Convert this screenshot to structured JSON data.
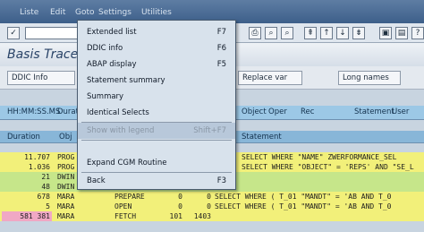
{
  "menubar": {
    "items": [
      "Liste",
      "Edit",
      "Goto",
      "Settings",
      "Utilities"
    ]
  },
  "title": "Basis Trace",
  "toolbar2": {
    "ddic_label": "DDIC Info",
    "replace_label": "Replace var",
    "long_names_label": "Long names"
  },
  "menu": {
    "items": [
      {
        "label": "Extended list",
        "shortcut": "F7",
        "disabled": false
      },
      {
        "label": "DDIC info",
        "shortcut": "F6",
        "disabled": false
      },
      {
        "label": "ABAP display",
        "shortcut": "F5",
        "disabled": false
      },
      {
        "label": "Statement summary",
        "shortcut": "",
        "disabled": false
      },
      {
        "label": "Summary",
        "shortcut": "",
        "disabled": false
      },
      {
        "label": "Identical Selects",
        "shortcut": "",
        "disabled": false
      },
      {
        "label": "Show with legend",
        "shortcut": "Shift+F7",
        "disabled": true
      },
      {
        "label": "Expand CGM Routine",
        "shortcut": "",
        "disabled": false
      },
      {
        "label": "Back",
        "shortcut": "F3",
        "disabled": false
      }
    ]
  },
  "grid": {
    "top_labels": [
      "HH:MM:SS.MS",
      "Duration",
      "Object",
      "Oper",
      "Rec",
      "RC",
      "Statement",
      "User"
    ],
    "col_labels": [
      "Duration",
      "Obj",
      "Statement"
    ],
    "rows": [
      {
        "dur": "11.707",
        "obj": "PROG",
        "oper": "",
        "rec": "",
        "rc": "",
        "stmt": "SELECT WHERE \"NAME\"   ZWERFORMANCE_SEL"
      },
      {
        "dur": "1.036",
        "obj": "PROG",
        "oper": "",
        "rec": "",
        "rc": "",
        "stmt": "SELECT WHERE \"OBJECT\" = 'REPS' AND \"SE_L"
      },
      {
        "dur": "21",
        "obj": "DWIN",
        "oper": "",
        "rec": "",
        "rc": "",
        "stmt": ""
      },
      {
        "dur": "48",
        "obj": "DWIN",
        "oper": "",
        "rec": "",
        "rc": "",
        "stmt": ""
      },
      {
        "dur": "678",
        "obj": "MARA",
        "oper": "PREPARE",
        "rec": "0",
        "rc": "0",
        "stmt": "SELECT WHERE ( T_01   \"MANDT\" = 'AB AND T_0"
      },
      {
        "dur": "5",
        "obj": "MARA",
        "oper": "OPEN",
        "rec": "0",
        "rc": "0",
        "stmt": "SELECT WHERE ( T_01   \"MANDT\" = 'AB AND T_0"
      },
      {
        "dur": "581 381",
        "obj": "MARA",
        "oper": "FETCH",
        "rec": "101",
        "rc": "1403",
        "stmt": ""
      }
    ]
  },
  "colors": {
    "menubar": "#3d5f8a",
    "grid_header": "#9cc8e6",
    "row_yellow": "#f2f07a",
    "row_green": "#c6e68a",
    "row_pink": "#f0a8c4"
  }
}
